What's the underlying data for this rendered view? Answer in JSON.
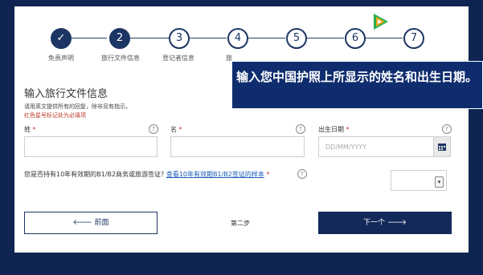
{
  "overlay": {
    "caption": "输入您中国护照上所显示的姓名和出生日期。",
    "logo_text": "腾讯视频"
  },
  "stepper": {
    "steps": [
      {
        "number": "✓",
        "label": "免责声明",
        "state": "done"
      },
      {
        "number": "2",
        "label": "旅行文件信息",
        "state": "active"
      },
      {
        "number": "3",
        "label": "登记者信息",
        "state": "pending"
      },
      {
        "number": "4",
        "label": "旅",
        "state": "pending"
      },
      {
        "number": "5",
        "label": "",
        "state": "pending"
      },
      {
        "number": "6",
        "label": "",
        "state": "pending"
      },
      {
        "number": "7",
        "label": "",
        "state": "pending"
      }
    ]
  },
  "form": {
    "title": "输入旅行文件信息",
    "instruction": "请用英文提供所有的回复，除非另有指示。",
    "required_note": "红色星号标记处为必填项",
    "surname_label": "姓",
    "given_name_label": "名",
    "dob_label": "出生日期",
    "required_mark": "*",
    "help_glyph": "?",
    "dob_placeholder": "DD/MM/YYYY",
    "visa_question": "您是否持有10年有效期的B1/B2商务或旅游签证?",
    "visa_sample_link": "查看10年有效期B1/B2签证的样本",
    "visa_required_mark": "*"
  },
  "nav": {
    "back_label": "🡐 前面",
    "step_text": "第二步",
    "next_label": "下一个 🡒"
  },
  "colors": {
    "navy": "#13295a",
    "required_red": "#c0392b",
    "link_blue": "#1a5bb8"
  }
}
